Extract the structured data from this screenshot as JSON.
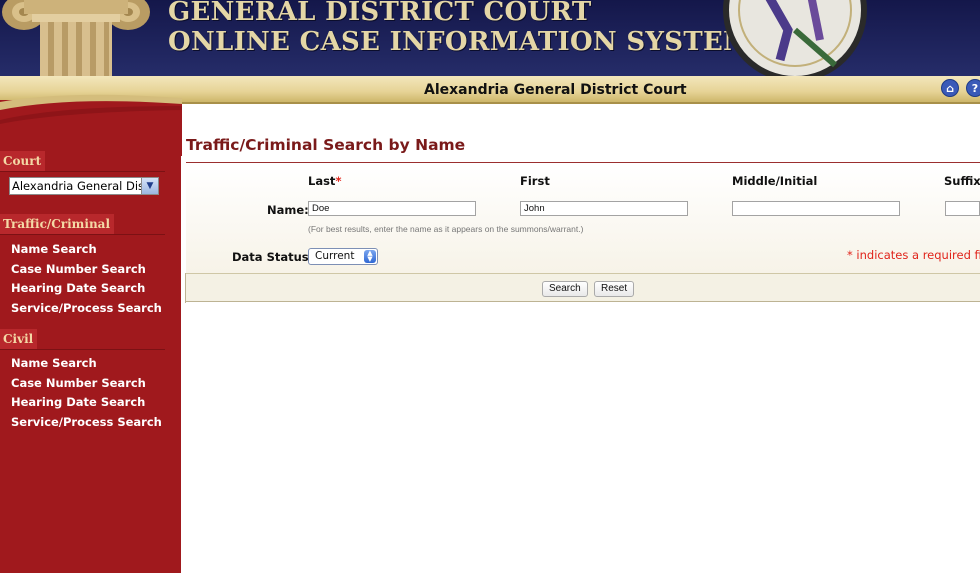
{
  "banner": {
    "title_line1": "GENERAL DISTRICT COURT",
    "title_line2": "ONLINE CASE INFORMATION SYSTEM"
  },
  "court_bar": {
    "court_name": "Alexandria General District Court"
  },
  "toolbar_icons": [
    "home-icon",
    "help-icon"
  ],
  "sidebar": {
    "court_tab": "Court",
    "court_select_value": "Alexandria General District Court",
    "traffic_tab": "Traffic/Criminal",
    "traffic_links": [
      "Name Search",
      "Case Number Search",
      "Hearing Date Search",
      "Service/Process Search"
    ],
    "civil_tab": "Civil",
    "civil_links": [
      "Name Search",
      "Case Number Search",
      "Hearing Date Search",
      "Service/Process Search"
    ]
  },
  "main": {
    "title": "Traffic/Criminal Search by Name",
    "columns": {
      "last": "Last",
      "first": "First",
      "middle": "Middle/Initial",
      "suffix": "Suffix"
    },
    "required_mark": "*",
    "name_label": "Name:",
    "last_value": "Doe",
    "first_value": "John",
    "middle_value": "",
    "suffix_value": "",
    "hint": "(For best results, enter the name as it appears on the summons/warrant.)",
    "data_status_label": "Data Status:",
    "data_status_value": "Current",
    "required_note": "* indicates a required field",
    "search_button": "Search",
    "reset_button": "Reset"
  },
  "colors": {
    "banner": "#1c2158",
    "sidebar": "#a0191d",
    "title": "#7a1a1a",
    "required": "#e0241b"
  }
}
